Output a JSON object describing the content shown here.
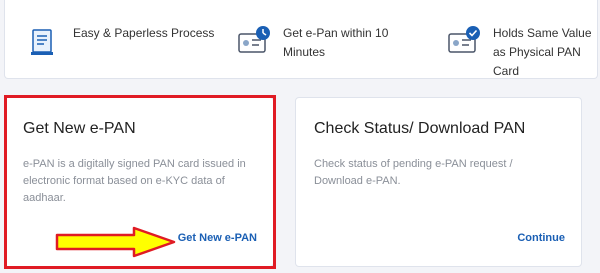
{
  "features": [
    {
      "label": "Easy & Paperless Process",
      "icon": "document-icon"
    },
    {
      "label": "Get e-Pan within 10 Minutes",
      "icon": "id-card-clock-icon"
    },
    {
      "label": "Holds Same Value as Physical PAN Card",
      "icon": "id-card-check-icon"
    }
  ],
  "cards": [
    {
      "title": "Get New e-PAN",
      "description": "e-PAN is a digitally signed PAN card issued in electronic format based on e-KYC data of aadhaar.",
      "action": "Get New e-PAN"
    },
    {
      "title": "Check Status/ Download PAN",
      "description": "Check status of pending e-PAN request / Download e-PAN.",
      "action": "Continue"
    }
  ],
  "colors": {
    "accent": "#1a5fb4",
    "highlight_border": "#e01b24",
    "arrow_fill": "#ffff00",
    "arrow_stroke": "#e01b24"
  }
}
